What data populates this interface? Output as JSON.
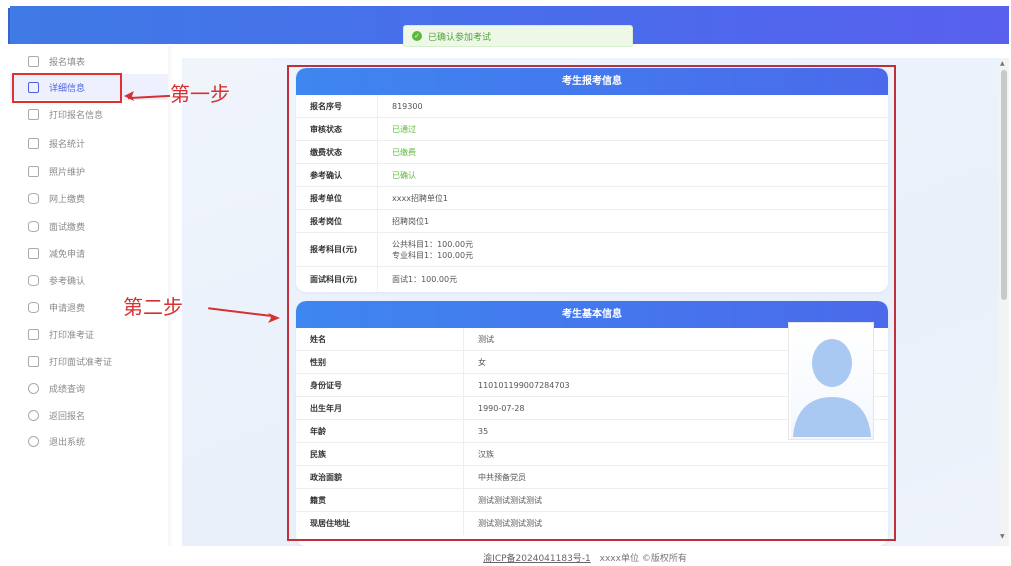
{
  "header": {
    "title": ""
  },
  "toast": {
    "message": "已确认参加考试"
  },
  "sidebar": {
    "items": [
      {
        "label": "报名填表"
      },
      {
        "label": "详细信息"
      },
      {
        "label": "打印报名信息"
      },
      {
        "label": "报名统计"
      },
      {
        "label": "照片维护"
      },
      {
        "label": "网上缴费"
      },
      {
        "label": "面试缴费"
      },
      {
        "label": "减免申请"
      },
      {
        "label": "参考确认"
      },
      {
        "label": "申请退费"
      },
      {
        "label": "打印准考证"
      },
      {
        "label": "打印面试准考证"
      },
      {
        "label": "成绩查询"
      },
      {
        "label": "返回报名"
      },
      {
        "label": "退出系统"
      }
    ]
  },
  "annotations": {
    "step1": "第一步",
    "step2": "第二步"
  },
  "exam_card": {
    "title": "考生报考信息",
    "rows": [
      {
        "label": "报名序号",
        "value": "819300"
      },
      {
        "label": "审核状态",
        "value": "已通过"
      },
      {
        "label": "缴费状态",
        "value": "已缴费"
      },
      {
        "label": "参考确认",
        "value": "已确认"
      },
      {
        "label": "报考单位",
        "value": "xxxx招聘单位1"
      },
      {
        "label": "报考岗位",
        "value": "招聘岗位1"
      },
      {
        "label": "报考科目(元)",
        "value": "公共科目1：100.00元",
        "value2": "专业科目1：100.00元"
      },
      {
        "label": "面试科目(元)",
        "value": "面试1：100.00元"
      }
    ]
  },
  "basic_card": {
    "title": "考生基本信息",
    "rows": [
      {
        "label": "姓名",
        "value": "测试"
      },
      {
        "label": "性别",
        "value": "女"
      },
      {
        "label": "身份证号",
        "value": "110101199007284703"
      },
      {
        "label": "出生年月",
        "value": "1990-07-28"
      },
      {
        "label": "年龄",
        "value": "35"
      },
      {
        "label": "民族",
        "value": "汉族"
      },
      {
        "label": "政治面貌",
        "value": "中共预备党员"
      },
      {
        "label": "籍贯",
        "value": "测试测试测试测试"
      },
      {
        "label": "现居住地址",
        "value": "测试测试测试测试"
      }
    ]
  },
  "footer": {
    "icp": "渝ICP备2024041183号-1",
    "copyright": "xxxx单位 ©版权所有"
  },
  "colors": {
    "accent": "#4a63df",
    "header": "#4b6bec",
    "success": "#5cb83a",
    "annotation": "#d63131"
  },
  "icons": [
    "edit-icon",
    "document-icon",
    "printer-icon",
    "chart-icon",
    "photo-icon",
    "database-icon",
    "search-icon",
    "power-icon"
  ]
}
